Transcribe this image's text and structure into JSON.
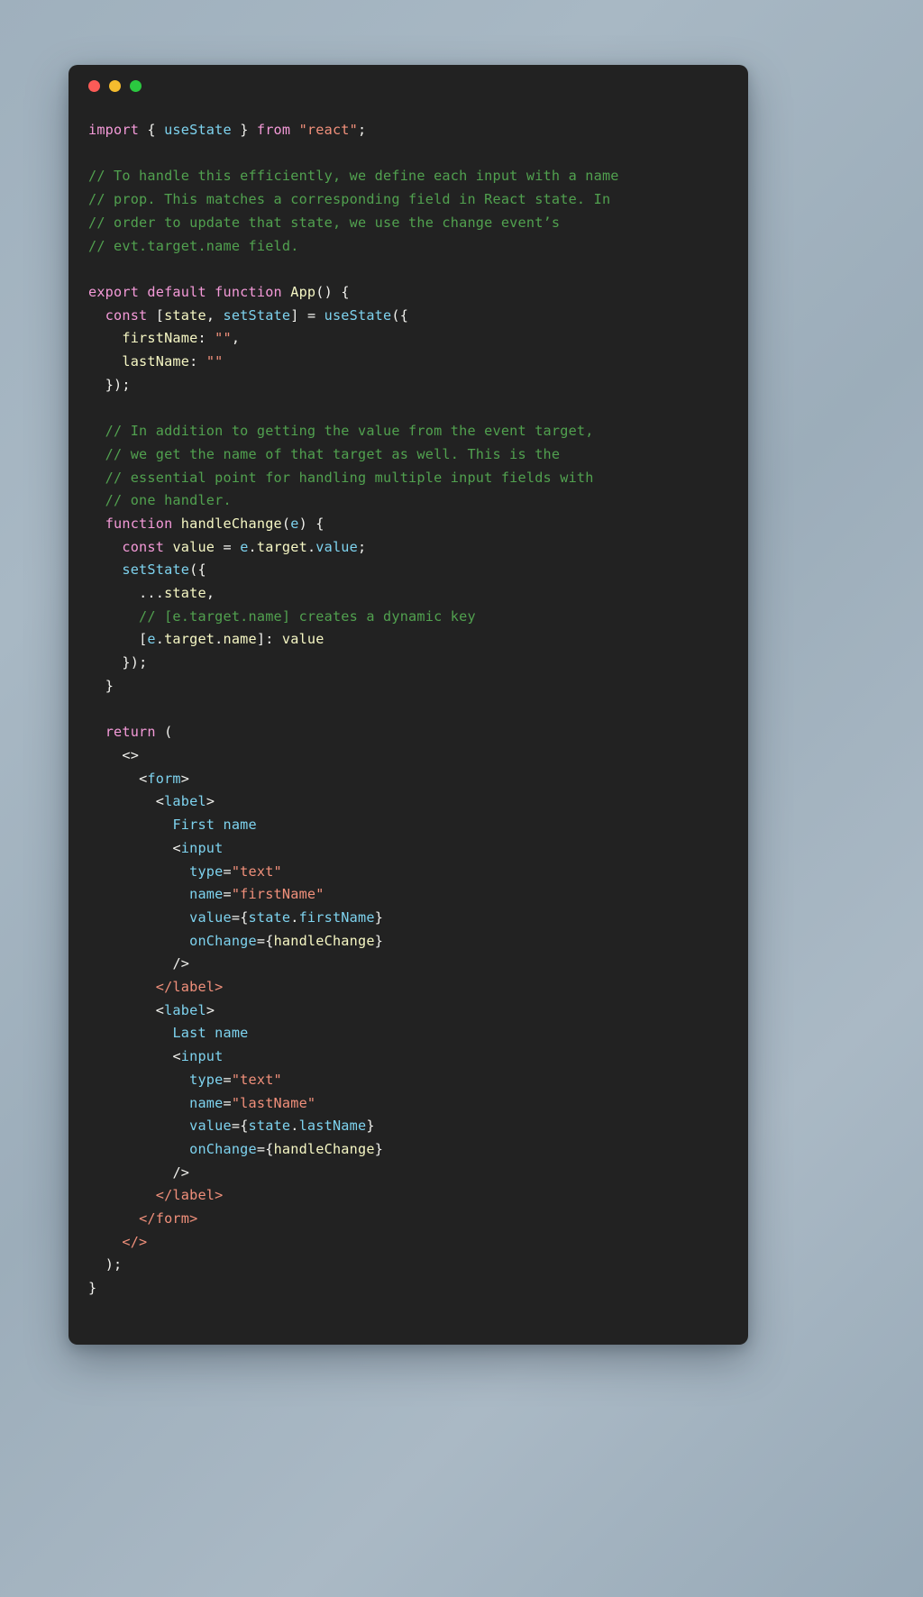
{
  "window": {
    "traffic_lights": [
      {
        "name": "close-button",
        "color": "#fc5b57"
      },
      {
        "name": "minimize-button",
        "color": "#f5bc2e"
      },
      {
        "name": "maximize-button",
        "color": "#2bc840"
      }
    ],
    "background": "#222222"
  },
  "theme": {
    "keyword": "#f49ad8",
    "comment": "#51a14f",
    "string": "#f1907b",
    "function": "#7ed3ef",
    "identifier": "#f6f7c4",
    "punctuation": "#f2f2ee",
    "jsx_tag": "#7ed3ef",
    "jsx_close_tag": "#f1907b",
    "attribute": "#7ed3ef",
    "page_background": "#9fb0bd"
  },
  "code": {
    "language": "jsx",
    "lines": [
      "import { useState } from \"react\";",
      "",
      "// To handle this efficiently, we define each input with a name",
      "// prop. This matches a corresponding field in React state. In",
      "// order to update that state, we use the change event’s",
      "// evt.target.name field.",
      "",
      "export default function App() {",
      "  const [state, setState] = useState({",
      "    firstName: \"\",",
      "    lastName: \"\"",
      "  });",
      "",
      "  // In addition to getting the value from the event target,",
      "  // we get the name of that target as well. This is the",
      "  // essential point for handling multiple input fields with",
      "  // one handler.",
      "  function handleChange(e) {",
      "    const value = e.target.value;",
      "    setState({",
      "      ...state,",
      "      // [e.target.name] creates a dynamic key",
      "      [e.target.name]: value",
      "    });",
      "  }",
      "",
      "  return (",
      "    <>",
      "      <form>",
      "        <label>",
      "          First name",
      "          <input",
      "            type=\"text\"",
      "            name=\"firstName\"",
      "            value={state.firstName}",
      "            onChange={handleChange}",
      "          />",
      "        </label>",
      "        <label>",
      "          Last name",
      "          <input",
      "            type=\"text\"",
      "            name=\"lastName\"",
      "            value={state.lastName}",
      "            onChange={handleChange}",
      "          />",
      "        </label>",
      "      </form>",
      "    </>",
      "  );",
      "}"
    ]
  }
}
